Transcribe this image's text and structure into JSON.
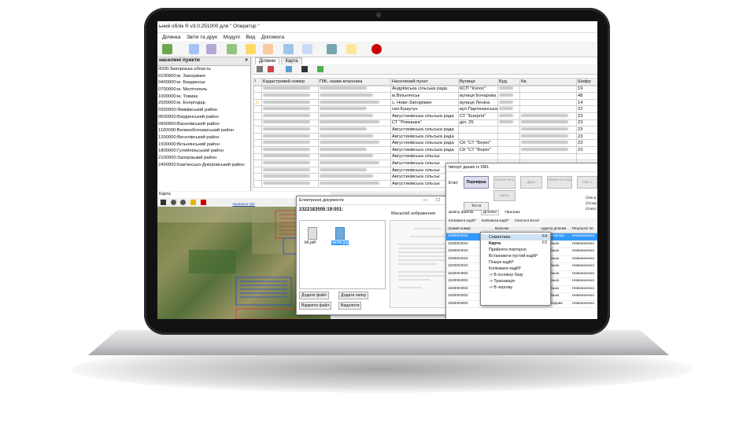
{
  "app": {
    "title": "ьний облік ® v3.0.251000 для \" Оператор  \""
  },
  "menu": [
    "Ділянка",
    "Звіти та друк",
    "Модулі",
    "Вид",
    "Допомога"
  ],
  "tree": {
    "header": "населені пункти",
    "items": [
      "0000:Запорізька область",
      "0100000:м. Запоріжжя",
      "0400000:м. Бердянськ",
      "0700000:м. Мелітополь",
      "1000000:м. Токмак",
      "2500000:м. Енергодар",
      "0300000:Якимівський район",
      "0600000:Бердянський район",
      "0900000:Василівський район",
      "1100000:Великобілозерський район",
      "1200000:Веселівський район",
      "1500000:Вільнянський район",
      "1800000:Гуляйпільський район",
      "2100000:Запорізький район",
      "2400000:Кам'янсько-Дніпровський район"
    ]
  },
  "tabs": [
    "Ділянки",
    "Карта"
  ],
  "grid": {
    "headers": [
      "!",
      "Кадастровий номер",
      "ПІБ, назва власника",
      "Населений пункт",
      "Вулиця",
      "Буд.",
      "Кв.",
      "Шифр"
    ],
    "rows": [
      {
        "pib_blur": true,
        "np": "Андріївська сільська рада",
        "street": "КСП \"Колос\"",
        "code": "19"
      },
      {
        "pib_blur": true,
        "np": "м.Вільнянськ",
        "street": "вулиця Бочарова",
        "code": "48"
      },
      {
        "pib_blur": true,
        "np": "с. Нове-Запоріжжя",
        "street": "вулиця Леніна",
        "code": "14"
      },
      {
        "pib_blur": true,
        "np": "смт.Кушугун",
        "street": "вул.Партизанська",
        "code": "22"
      },
      {
        "pib_blur": true,
        "np": "Августинівська сільська рада",
        "street": "СТ \"Енергія\"",
        "code": "23"
      },
      {
        "pib_blur": true,
        "np": "СТ \"Ромашка\"",
        "street": "діл. 25",
        "code": "23"
      },
      {
        "pib_blur": true,
        "np": "Августинівська сільська рада",
        "street": "",
        "code": "23"
      },
      {
        "pib_blur": true,
        "np": "Августинівська сільська рада",
        "street": "",
        "code": "23"
      },
      {
        "pib_blur": true,
        "np": "Августинівська сільська рада",
        "street": "СК \"СТ \"Берег\"",
        "code": "23"
      },
      {
        "pib_blur": true,
        "np": "Августинівська сільська рада",
        "street": "СК \"СТ \"Берег\"",
        "code": "23"
      },
      {
        "pib_blur": true,
        "np": "Августинівська сільськ",
        "street": "",
        "code": ""
      },
      {
        "pib_blur": true,
        "np": "Августинівська сільськ",
        "street": "",
        "code": ""
      },
      {
        "pib_blur": true,
        "np": "Августинівська сільськ",
        "street": "",
        "code": ""
      },
      {
        "pib_blur": true,
        "np": "Августинівська сільськ",
        "street": "",
        "code": ""
      },
      {
        "pib_blur": true,
        "np": "Августинівська сільськ",
        "street": "",
        "code": ""
      }
    ]
  },
  "map": {
    "header": "Карта",
    "link": "первинне звіт"
  },
  "edocs": {
    "title": "Електронні документи",
    "cadastral": "2322183505:19:001:",
    "scale_label": "Масштаб зображення:",
    "files": [
      "b6.pdf",
      "вилиг.jpg"
    ],
    "btn_add_file": "Додати файл",
    "btn_add_folder": "Додати папку",
    "btn_open_file": "Відкрити файл",
    "btn_delete": "Видалити"
  },
  "xml": {
    "title": "Імпорт даних із XML",
    "stage_label": "Етап:",
    "steps": [
      "Перевірка",
      "Сполу-чено",
      "Друк",
      "Зберегти в БД",
      "XML з"
    ],
    "btn_map": "Карта",
    "btn_tests": "Тести",
    "tabs": [
      "файлу файлів",
      "Ділянки",
      "Програм"
    ],
    "subtoolbar": [
      "Копіювати кадNº",
      "Копіювати кадNº",
      "Список в Excel"
    ],
    "columns": [
      "тровий номер",
      "Власник",
      "Адреса ділянки",
      "Результат пе"
    ],
    "rows": [
      "1530004010",
      "1530004010",
      "1530004010",
      "1530004010",
      "1530004010",
      "1530004002",
      "1530004002",
      "1530004002",
      "1530004002",
      "1530004002"
    ],
    "addresses": [
      "с.Нове-Запорі",
      "Запорізька",
      "Запорізька",
      "Запорізька",
      "Запорізька",
      "Запорізька",
      "Запорізька",
      "Запорізька",
      "Запорізька",
      "Скороходове"
    ],
    "results": [
      "Невизначено",
      "Невизначено",
      "Невизначено",
      "Невизначено",
      "Невизначено",
      "Невизначено",
      "Невизначено",
      "Невизначено",
      "Невизначено",
      "Невизначено"
    ],
    "checks": [
      "Не в",
      "Стер",
      "Авто"
    ]
  },
  "context_menu": [
    "Семантика",
    "Карта",
    "Прийняти повторно",
    "Встановити пустий кадNº",
    "Пошук кадNº",
    "Копіювати кадNº",
    "-> В основну базу",
    "-> Транзакція",
    "-> В чергову"
  ],
  "context_shortcuts": {
    "Семантика": "F4",
    "Карта": "F2"
  }
}
